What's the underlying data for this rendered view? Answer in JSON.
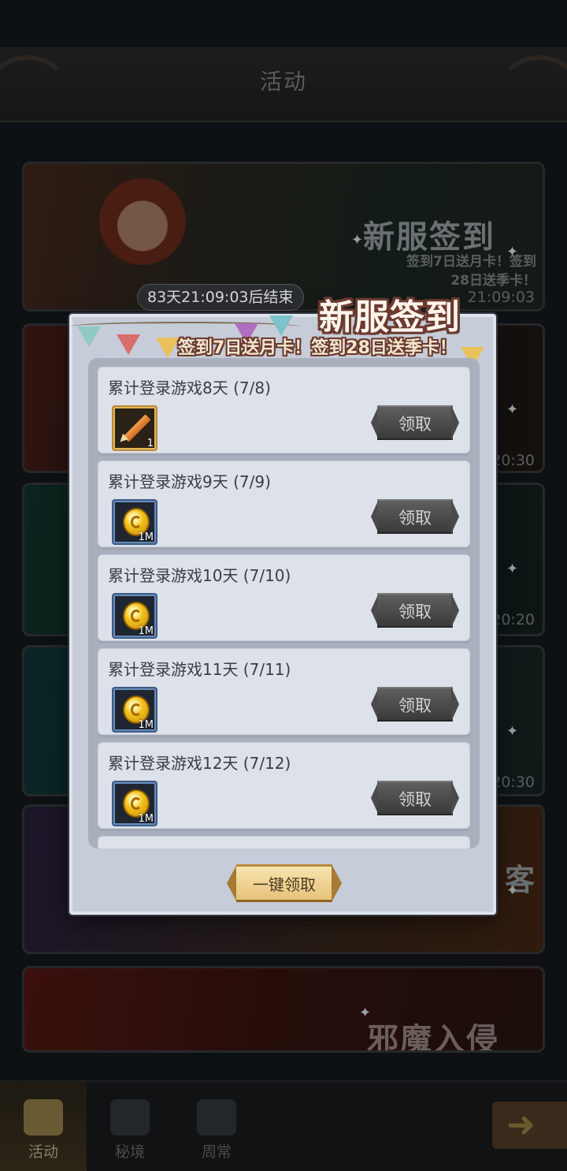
{
  "header": {
    "title": "活动"
  },
  "banners": [
    {
      "title": "新服签到",
      "subtitle_line1": "签到7日送月卡！签到",
      "subtitle_line2": "28日送季卡！",
      "time": "21:09:03"
    },
    {
      "time": "20:30"
    },
    {
      "time": "20:20"
    },
    {
      "time": "20:30"
    },
    {
      "title_partial": "客"
    },
    {
      "title": "邪魔入侵"
    }
  ],
  "end_timer": "83天21:09:03后结束",
  "modal": {
    "title": "新服签到",
    "subtitle": "签到7日送月卡！签到28日送季卡！",
    "claim_all_label": "一键领取",
    "rows": [
      {
        "label": "累计登录游戏8天 (7/8)",
        "item_icon": "pencil-icon",
        "qty": "1",
        "button": "领取"
      },
      {
        "label": "累计登录游戏9天 (7/9)",
        "item_icon": "gold-coin-icon",
        "qty": "1M",
        "button": "领取"
      },
      {
        "label": "累计登录游戏10天 (7/10)",
        "item_icon": "gold-coin-icon",
        "qty": "1M",
        "button": "领取"
      },
      {
        "label": "累计登录游戏11天 (7/11)",
        "item_icon": "gold-coin-icon",
        "qty": "1M",
        "button": "领取"
      },
      {
        "label": "累计登录游戏12天 (7/12)",
        "item_icon": "gold-coin-icon",
        "qty": "1M",
        "button": "领取"
      }
    ]
  },
  "bottom_nav": {
    "tabs": [
      {
        "label": "活动",
        "active": true
      },
      {
        "label": "秘境",
        "active": false
      },
      {
        "label": "周常",
        "active": false
      }
    ]
  },
  "colors": {
    "modal_bg": "#c6ccd8",
    "title_outline": "#6b3a2f",
    "claim_button": "#4a4a4a",
    "claim_all_button": "#e7c37a"
  }
}
